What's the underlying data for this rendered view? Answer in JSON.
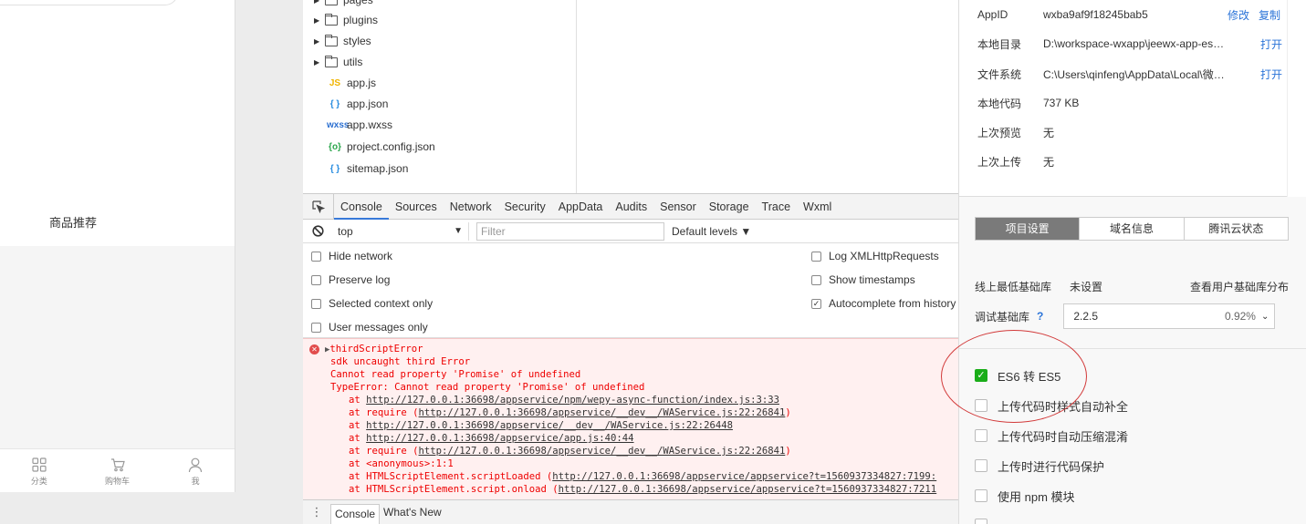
{
  "simulator": {
    "section_title": "商品推荐",
    "tabs": [
      {
        "label": "分类",
        "icon": "grid-icon"
      },
      {
        "label": "购物车",
        "icon": "cart-icon"
      },
      {
        "label": "我",
        "icon": "user-icon"
      }
    ]
  },
  "file_tree": {
    "folders": [
      "pages",
      "plugins",
      "styles",
      "utils"
    ],
    "files": [
      {
        "name": "app.js",
        "icon": "JS"
      },
      {
        "name": "app.json",
        "icon": "{ }"
      },
      {
        "name": "app.wxss",
        "icon": "wxss"
      },
      {
        "name": "project.config.json",
        "icon": "{o}"
      },
      {
        "name": "sitemap.json",
        "icon": "{ }"
      }
    ]
  },
  "devtools": {
    "tabs": [
      "Console",
      "Sources",
      "Network",
      "Security",
      "AppData",
      "Audits",
      "Sensor",
      "Storage",
      "Trace",
      "Wxml"
    ],
    "active_tab": "Console",
    "context": "top",
    "filter_placeholder": "Filter",
    "levels": "Default levels ▼",
    "settings_left": [
      {
        "label": "Hide network",
        "checked": false
      },
      {
        "label": "Preserve log",
        "checked": false
      },
      {
        "label": "Selected context only",
        "checked": false
      },
      {
        "label": "User messages only",
        "checked": false
      }
    ],
    "settings_right": [
      {
        "label": "Log XMLHttpRequests",
        "checked": false
      },
      {
        "label": "Show timestamps",
        "checked": false
      },
      {
        "label": "Autocomplete from history",
        "checked": true
      }
    ],
    "error": {
      "title": "thirdScriptError",
      "lines": [
        "sdk uncaught third Error",
        "Cannot read property 'Promise' of undefined",
        "TypeError: Cannot read property 'Promise' of undefined"
      ],
      "stack": [
        {
          "prefix": "at ",
          "link": "http://127.0.0.1:36698/appservice/npm/wepy-async-function/index.js:3:33",
          "suffix": ""
        },
        {
          "prefix": "at require (",
          "link": "http://127.0.0.1:36698/appservice/__dev__/WAService.js:22:26841",
          "suffix": ")"
        },
        {
          "prefix": "at ",
          "link": "http://127.0.0.1:36698/appservice/__dev__/WAService.js:22:26448",
          "suffix": ""
        },
        {
          "prefix": "at ",
          "link": "http://127.0.0.1:36698/appservice/app.js:40:44",
          "suffix": ""
        },
        {
          "prefix": "at require (",
          "link": "http://127.0.0.1:36698/appservice/__dev__/WAService.js:22:26841",
          "suffix": ")"
        },
        {
          "prefix": "at <anonymous>:1:1",
          "link": "",
          "suffix": ""
        },
        {
          "prefix": "at HTMLScriptElement.scriptLoaded (",
          "link": "http://127.0.0.1:36698/appservice/appservice?t=1560937334827:7199:",
          "suffix": ""
        },
        {
          "prefix": "at HTMLScriptElement.script.onload (",
          "link": "http://127.0.0.1:36698/appservice/appservice?t=1560937334827:7211",
          "suffix": ""
        }
      ]
    },
    "drawer_tabs": [
      "Console",
      "What's New"
    ]
  },
  "project": {
    "info": [
      {
        "label": "AppID",
        "value": "wxba9af9f18245bab5",
        "links": [
          "修改",
          "复制"
        ]
      },
      {
        "label": "本地目录",
        "value": "D:\\workspace-wxapp\\jeewx-app-eshop\\...",
        "links": [
          "打开"
        ]
      },
      {
        "label": "文件系统",
        "value": "C:\\Users\\qinfeng\\AppData\\Local\\微信we...",
        "links": [
          "打开"
        ]
      },
      {
        "label": "本地代码",
        "value": "737 KB",
        "links": []
      },
      {
        "label": "上次预览",
        "value": "无",
        "links": []
      },
      {
        "label": "上次上传",
        "value": "无",
        "links": []
      }
    ],
    "segments": [
      "项目设置",
      "域名信息",
      "腾讯云状态"
    ],
    "active_segment": "项目设置",
    "base_lib_label": "线上最低基础库",
    "base_lib_value": "未设置",
    "base_lib_link": "查看用户基础库分布",
    "debug_lib_label": "调试基础库",
    "debug_lib_help": "?",
    "debug_lib_version": "2.2.5",
    "debug_lib_percent": "0.92%",
    "options": [
      {
        "label": "ES6 转 ES5",
        "checked": true
      },
      {
        "label": "上传代码时样式自动补全",
        "checked": false
      },
      {
        "label": "上传代码时自动压缩混淆",
        "checked": false
      },
      {
        "label": "上传时进行代码保护",
        "checked": false
      },
      {
        "label": "使用 npm 模块",
        "checked": false
      }
    ]
  },
  "colors": {
    "accent_link": "#2b74d8",
    "checkbox_on": "#1aad19",
    "error_text": "#e00000",
    "annotation": "#d23a3a"
  }
}
